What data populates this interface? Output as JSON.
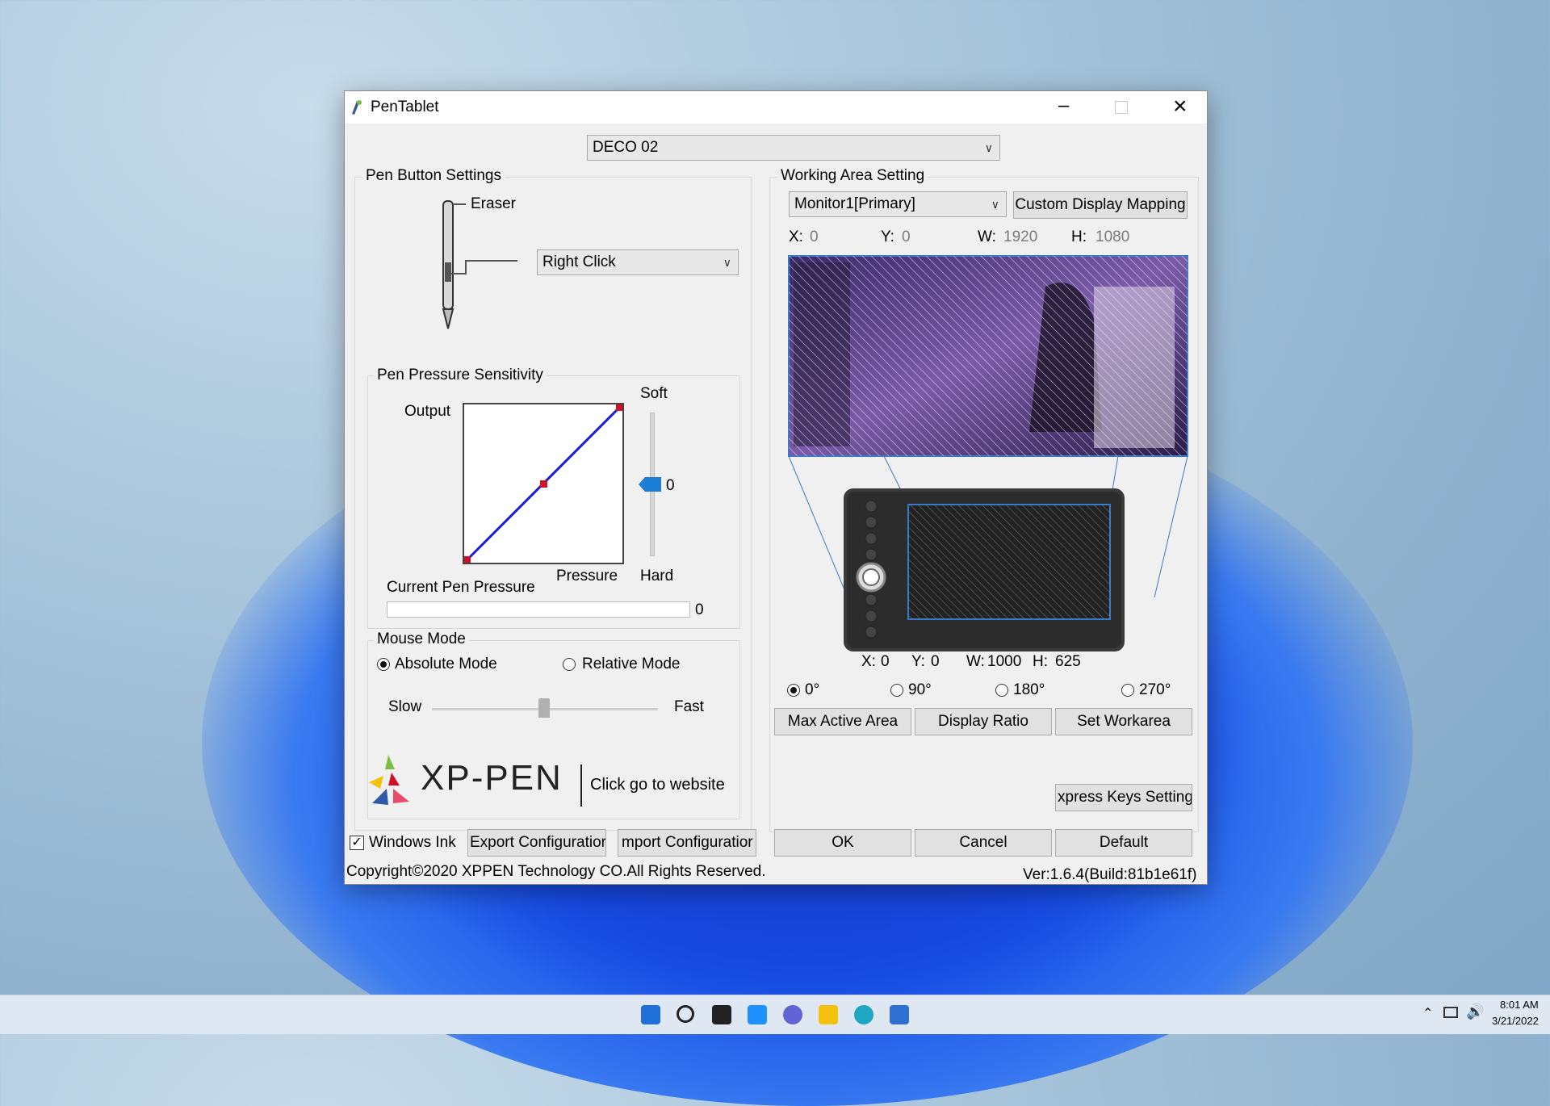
{
  "window": {
    "title": "PenTablet"
  },
  "device": {
    "selected": "DECO 02"
  },
  "pen_button": {
    "group_label": "Pen Button Settings",
    "eraser_label": "Eraser",
    "button_action": "Right Click"
  },
  "pressure": {
    "group_label": "Pen Pressure Sensitivity",
    "output_label": "Output",
    "pressure_label": "Pressure",
    "soft_label": "Soft",
    "hard_label": "Hard",
    "slider_value": "0",
    "current_label": "Current Pen Pressure",
    "current_value": "0"
  },
  "mouse_mode": {
    "group_label": "Mouse Mode",
    "absolute": "Absolute Mode",
    "relative": "Relative Mode",
    "slow": "Slow",
    "fast": "Fast",
    "selected": "absolute"
  },
  "working_area": {
    "group_label": "Working Area Setting",
    "monitor": "Monitor1[Primary]",
    "custom_mapping": "Custom Display Mapping",
    "screen": {
      "x_label": "X:",
      "x": "0",
      "y_label": "Y:",
      "y": "0",
      "w_label": "W:",
      "w": "1920",
      "h_label": "H:",
      "h": "1080"
    },
    "tablet": {
      "x_label": "X:",
      "x": "0",
      "y_label": "Y:",
      "y": "0",
      "w_label": "W:",
      "w": "1000",
      "h_label": "H:",
      "h": "625"
    },
    "rotations": [
      "0°",
      "90°",
      "180°",
      "270°"
    ],
    "rotation_selected": "0°",
    "max_active": "Max Active Area",
    "display_ratio": "Display Ratio",
    "set_workarea": "Set Workarea"
  },
  "brand": {
    "name": "XP-PEN",
    "website": "Click go to website"
  },
  "express_keys": "xpress Keys Setting",
  "footer": {
    "windows_ink": "Windows Ink",
    "windows_ink_checked": true,
    "export": "Export Configuratior",
    "import": "mport Configuratior",
    "ok": "OK",
    "cancel": "Cancel",
    "default": "Default",
    "copyright": "Copyright©2020  XPPEN Technology CO.All Rights Reserved.",
    "version": "Ver:1.6.4(Build:81b1e61f)"
  },
  "taskbar": {
    "time": "8:01 AM",
    "date": "3/21/2022"
  },
  "colors": {
    "curve": "#1a1adf",
    "handle": "#d0102a",
    "slider_thumb": "#1a7fd4",
    "taskbar": "#dfe8f2"
  }
}
